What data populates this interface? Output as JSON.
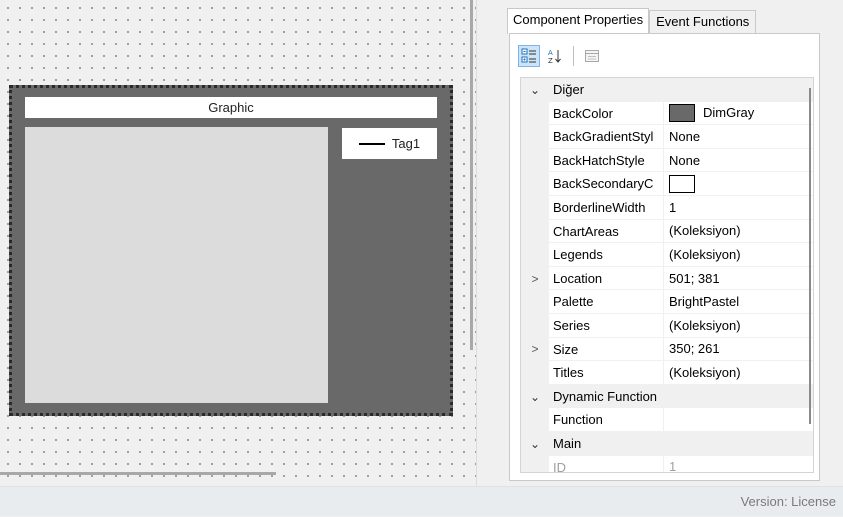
{
  "designer": {
    "chart": {
      "title": "Graphic",
      "legend_label": "Tag1"
    }
  },
  "panel": {
    "tabs": [
      {
        "label": "Component Properties",
        "active": true
      },
      {
        "label": "Event Functions",
        "active": false
      }
    ],
    "toolbar": {
      "categorized_icon": "categorized-icon",
      "alphabetical_icon": "sort-az-icon",
      "property_pages_icon": "property-pages-icon"
    },
    "grid": {
      "rows": [
        {
          "type": "category",
          "expander": "⌄",
          "name": "Diğer"
        },
        {
          "type": "prop",
          "expander": "",
          "name": "BackColor",
          "value": "DimGray",
          "swatch": "#696969"
        },
        {
          "type": "prop",
          "expander": "",
          "name": "BackGradientStyl",
          "value": "None"
        },
        {
          "type": "prop",
          "expander": "",
          "name": "BackHatchStyle",
          "value": "None"
        },
        {
          "type": "prop",
          "expander": "",
          "name": "BackSecondaryC",
          "value": "",
          "swatch": "#ffffff"
        },
        {
          "type": "prop",
          "expander": "",
          "name": "BorderlineWidth",
          "value": "1"
        },
        {
          "type": "prop",
          "expander": "",
          "name": "ChartAreas",
          "value": "(Koleksiyon)"
        },
        {
          "type": "prop",
          "expander": "",
          "name": "Legends",
          "value": "(Koleksiyon)"
        },
        {
          "type": "prop",
          "expander": ">",
          "name": "Location",
          "value": "501; 381"
        },
        {
          "type": "prop",
          "expander": "",
          "name": "Palette",
          "value": "BrightPastel"
        },
        {
          "type": "prop",
          "expander": "",
          "name": "Series",
          "value": "(Koleksiyon)"
        },
        {
          "type": "prop",
          "expander": ">",
          "name": "Size",
          "value": "350; 261"
        },
        {
          "type": "prop",
          "expander": "",
          "name": "Titles",
          "value": "(Koleksiyon)"
        },
        {
          "type": "category",
          "expander": "⌄",
          "name": "Dynamic Function"
        },
        {
          "type": "prop",
          "expander": "",
          "name": "Function",
          "value": ""
        },
        {
          "type": "category",
          "expander": "⌄",
          "name": "Main"
        },
        {
          "type": "prop",
          "expander": "",
          "name": "ID",
          "value": "1",
          "dim": true
        }
      ]
    }
  },
  "status": {
    "text": "Version: License"
  }
}
